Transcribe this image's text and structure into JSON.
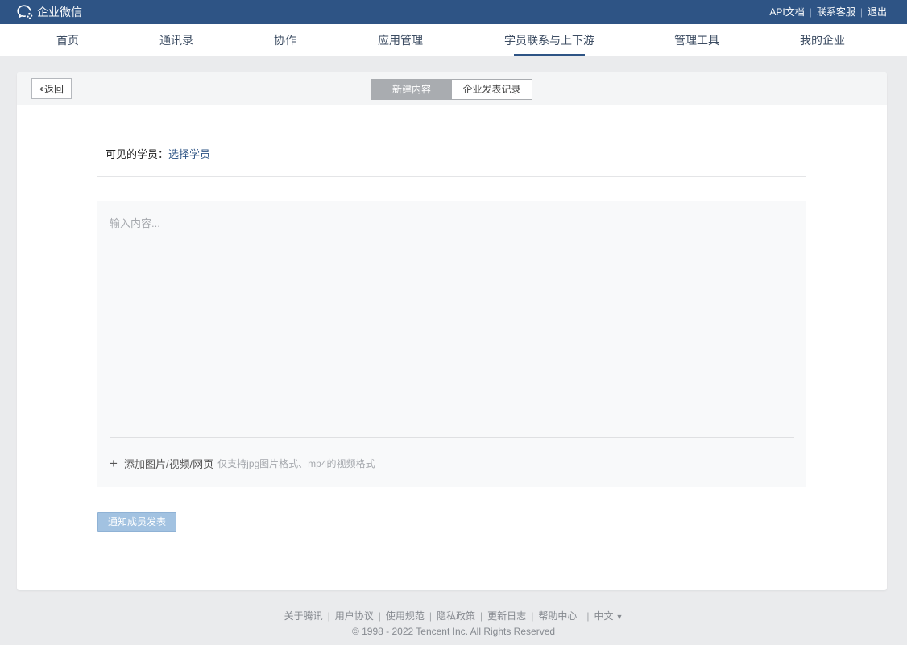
{
  "app": {
    "logo_text": "企业微信"
  },
  "top_links": {
    "api_docs": "API文档",
    "support": "联系客服",
    "logout": "退出",
    "separator": "|"
  },
  "nav": {
    "items": [
      {
        "label": "首页"
      },
      {
        "label": "通讯录"
      },
      {
        "label": "协作"
      },
      {
        "label": "应用管理"
      },
      {
        "label": "学员联系与上下游",
        "active": true
      },
      {
        "label": "管理工具"
      },
      {
        "label": "我的企业"
      }
    ]
  },
  "panel": {
    "back_label": "返回",
    "tabs": [
      {
        "label": "新建内容",
        "active": true
      },
      {
        "label": "企业发表记录",
        "active": false
      }
    ],
    "visible_label": "可见的学员：",
    "select_students": "选择学员",
    "editor_placeholder": "输入内容...",
    "attach_label": "添加图片/视频/网页",
    "attach_hint": "仅支持jpg图片格式、mp4的视频格式",
    "submit_label": "通知成员发表"
  },
  "footer": {
    "links": [
      "关于腾讯",
      "用户协议",
      "使用规范",
      "隐私政策",
      "更新日志",
      "帮助中心"
    ],
    "language": "中文",
    "copyright": "© 1998 - 2022 Tencent Inc. All Rights Reserved"
  },
  "colors": {
    "topbar": "#2e5485",
    "nav_active": "#2e5485",
    "link": "#2e5485",
    "submit_disabled": "#a2c2e1",
    "page_bg": "#eaebed"
  }
}
